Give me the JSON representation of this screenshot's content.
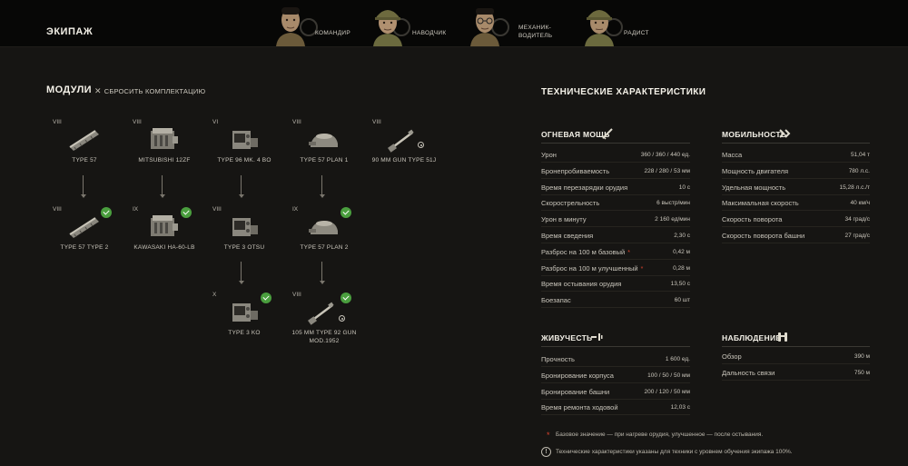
{
  "crew": {
    "title": "ЭКИПАЖ",
    "members": [
      {
        "role": "КОМАНДИР",
        "icon": "commander-icon"
      },
      {
        "role": "НАВОДЧИК",
        "icon": "gunner-icon"
      },
      {
        "role_line1": "МЕХАНИК-",
        "role_line2": "ВОДИТЕЛЬ",
        "icon": "driver-icon"
      },
      {
        "role": "РАДИСТ",
        "icon": "radio-icon"
      }
    ]
  },
  "modules": {
    "title": "МОДУЛИ",
    "reset_label": "СБРОСИТЬ КОМПЛЕКТАЦИЮ",
    "items": [
      {
        "tier": "VIII",
        "name": "TYPE 57",
        "type": "tracks"
      },
      {
        "tier": "VIII",
        "name": "MITSUBISHI 12ZF",
        "type": "engine"
      },
      {
        "tier": "VI",
        "name": "TYPE 96 MK. 4 BO",
        "type": "radio"
      },
      {
        "tier": "VIII",
        "name": "TYPE 57 PLAN 1",
        "type": "turret"
      },
      {
        "tier": "VIII",
        "name": "90 MM GUN TYPE 51J",
        "type": "gun"
      },
      {
        "tier": "VIII",
        "name": "TYPE 57 TYPE 2",
        "type": "tracks"
      },
      {
        "tier": "IX",
        "name": "KAWASAKI HA-60-LB",
        "type": "engine"
      },
      {
        "tier": "VIII",
        "name": "TYPE 3 OTSU",
        "type": "radio"
      },
      {
        "tier": "IX",
        "name": "TYPE 57 PLAN 2",
        "type": "turret"
      },
      {
        "tier": "X",
        "name": "TYPE 3 KO",
        "type": "radio"
      },
      {
        "tier": "VIII",
        "name_line1": "105 MM TYPE 92 GUN",
        "name_line2": "MOD.1952",
        "type": "gun"
      }
    ]
  },
  "specs": {
    "title": "ТЕХНИЧЕСКИЕ ХАРАКТЕРИСТИКИ",
    "firepower": {
      "title": "ОГНЕВАЯ МОЩЬ",
      "rows": [
        {
          "k": "Урон",
          "v": "360 / 360 / 440 ед."
        },
        {
          "k": "Бронепробиваемость",
          "v": "228 / 280 / 53 мм"
        },
        {
          "k": "Время перезарядки орудия",
          "v": "10 с"
        },
        {
          "k": "Скорострельность",
          "v": "6 выстр/мин"
        },
        {
          "k": "Урон в минуту",
          "v": "2 160 ед/мин"
        },
        {
          "k": "Время сведения",
          "v": "2,30 с"
        },
        {
          "k": "Разброс на 100 м базовый",
          "v": "0,42 м",
          "asterisk": "*"
        },
        {
          "k": "Разброс на 100 м улучшенный",
          "v": "0,28 м",
          "asterisk": "*"
        },
        {
          "k": "Время остывания орудия",
          "v": "13,50 с"
        },
        {
          "k": "Боезапас",
          "v": "60 шт"
        }
      ]
    },
    "mobility": {
      "title": "МОБИЛЬНОСТЬ",
      "rows": [
        {
          "k": "Масса",
          "v": "51,04 т"
        },
        {
          "k": "Мощность двигателя",
          "v": "780 л.с."
        },
        {
          "k": "Удельная мощность",
          "v": "15,28 л.с./т"
        },
        {
          "k": "Максимальная скорость",
          "v": "40 км/ч"
        },
        {
          "k": "Скорость поворота",
          "v": "34 град/с"
        },
        {
          "k": "Скорость поворота башни",
          "v": "27 град/с"
        }
      ]
    },
    "survivability": {
      "title": "ЖИВУЧЕСТЬ",
      "rows": [
        {
          "k": "Прочность",
          "v": "1 600 ед."
        },
        {
          "k": "Бронирование корпуса",
          "v": "100 / 50 / 50 мм"
        },
        {
          "k": "Бронирование башни",
          "v": "200 / 120 / 50 мм"
        },
        {
          "k": "Время ремонта ходовой",
          "v": "12,03 с"
        }
      ]
    },
    "observation": {
      "title": "НАБЛЮДЕНИЕ",
      "rows": [
        {
          "k": "Обзор",
          "v": "390 м"
        },
        {
          "k": "Дальность связи",
          "v": "750 м"
        }
      ]
    },
    "note_asterisk": "*",
    "note_text": "Базовое значение — при нагреве орудия, улучшенное — после остывания.",
    "info_text": "Технические характеристики указаны для техники с уровнем обучения экипажа 100%."
  },
  "colors": {
    "accent_red": "#d8432d",
    "check_green": "#4a9e3e",
    "background": "#161513"
  }
}
